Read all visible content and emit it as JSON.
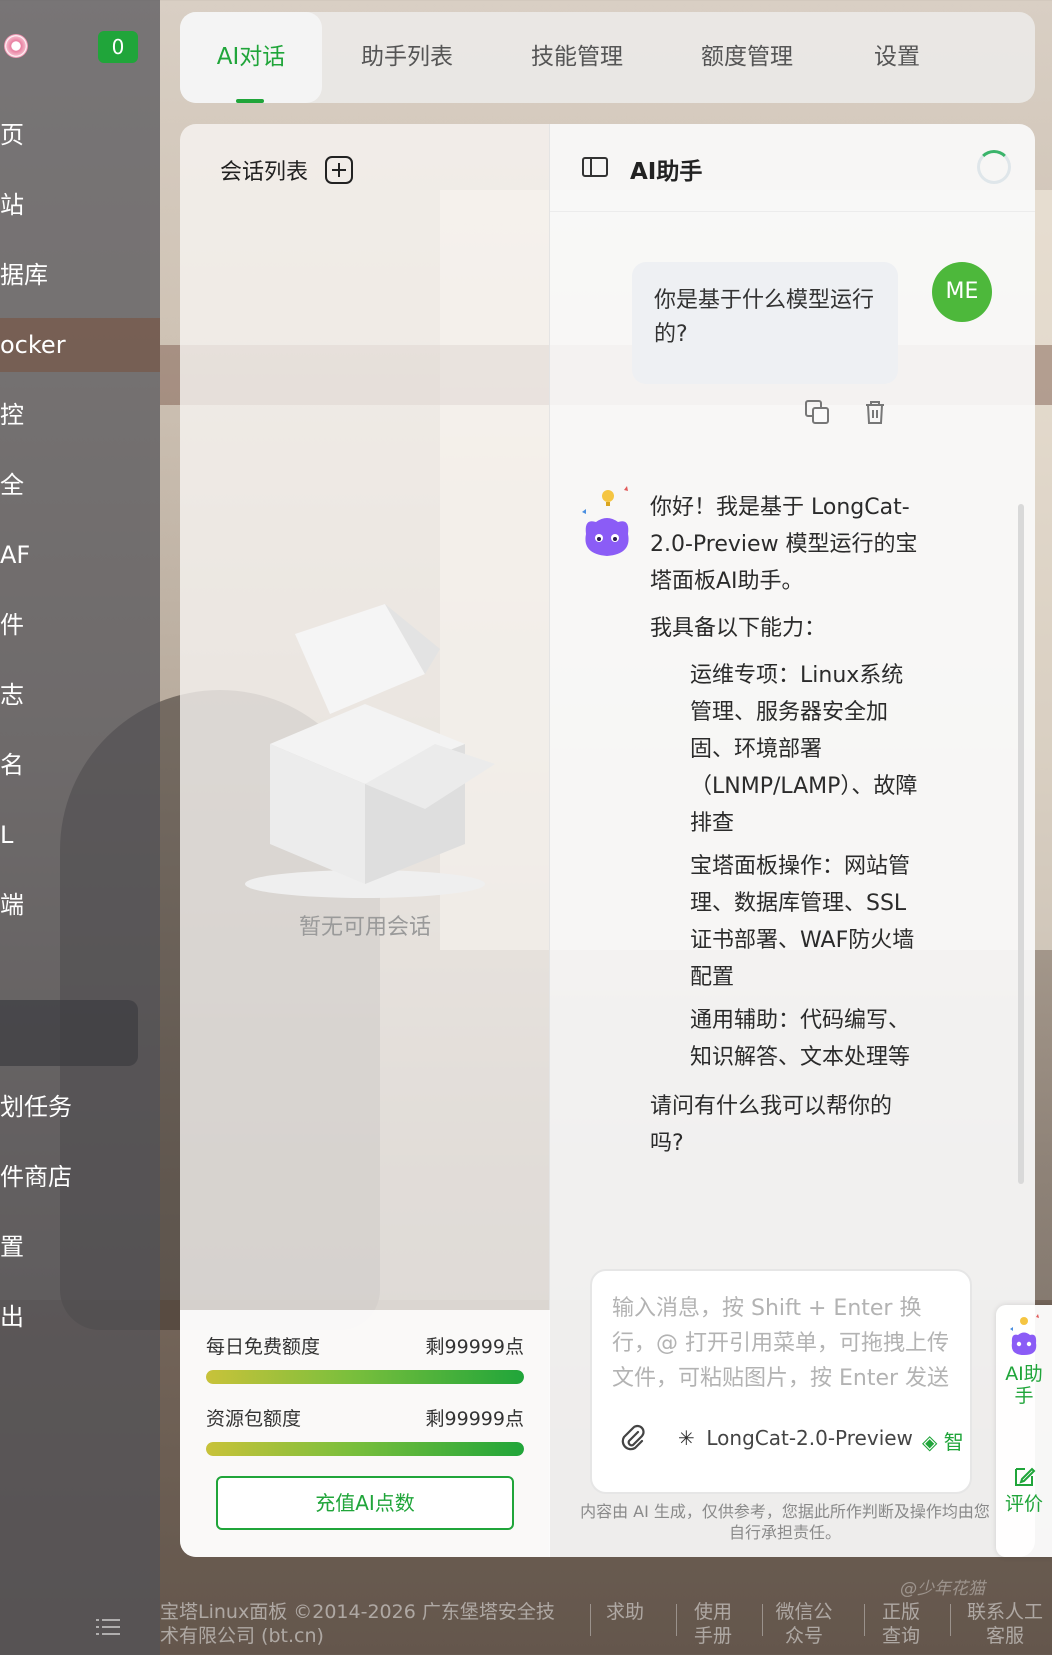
{
  "sidebar": {
    "badge": "0",
    "items": [
      {
        "label": "页"
      },
      {
        "label": "站"
      },
      {
        "label": "据库"
      },
      {
        "label": "ocker"
      },
      {
        "label": "控"
      },
      {
        "label": "全"
      },
      {
        "label": "AF"
      },
      {
        "label": "件"
      },
      {
        "label": "志"
      },
      {
        "label": "名"
      },
      {
        "label": "L"
      },
      {
        "label": "端"
      },
      {
        "label": ""
      },
      {
        "label": "划任务"
      },
      {
        "label": "件商店"
      },
      {
        "label": "置"
      },
      {
        "label": "出"
      }
    ]
  },
  "tabs": [
    {
      "label": "AI对话"
    },
    {
      "label": "助手列表"
    },
    {
      "label": "技能管理"
    },
    {
      "label": "额度管理"
    },
    {
      "label": "设置"
    }
  ],
  "session_list": {
    "title": "会话列表",
    "empty_text": "暂无可用会话"
  },
  "quota": {
    "daily_label": "每日免费额度",
    "daily_value": "剩99999点",
    "daily_fraction": 1.0,
    "package_label": "资源包额度",
    "package_value": "剩99999点",
    "package_fraction": 1.0,
    "recharge_label": "充值AI点数"
  },
  "chat": {
    "title": "AI助手",
    "user_avatar": "ME",
    "user_message": "你是基于什么模型运行的?",
    "ai_intro": "你好！我是基于 LongCat-2.0-Preview 模型运行的宝塔面板AI助手。",
    "ai_capabilities_title": "我具备以下能力：",
    "ai_capabilities": [
      "运维专项：Linux系统管理、服务器安全加固、环境部署（LNMP/LAMP）、故障排查",
      "宝塔面板操作：网站管理、数据库管理、SSL证书部署、WAF防火墙配置",
      "通用辅助：代码编写、知识解答、文本处理等"
    ],
    "ai_closing": "请问有什么我可以帮你的吗?",
    "input_placeholder": "输入消息，按 Shift + Enter 换行，@ 打开引用菜单，可拖拽上传文件，可粘贴图片，按 Enter 发送",
    "model_name": "LongCat-2.0-Preview",
    "smart_label": "智",
    "disclaimer": "内容由 AI 生成，仅供参考，您据此所作判断及操作均由您自行承担责任。"
  },
  "float_widget": {
    "ai_label": "AI助手",
    "rate_label": "评价"
  },
  "footer": {
    "copyright": "宝塔Linux面板 ©2014-2026 广东堡塔安全技术有限公司 (bt.cn)",
    "links": [
      "求助",
      "使用手册",
      "微信公众号",
      "正版查询",
      "联系人工客服"
    ]
  },
  "watermark": "@少年花猫"
}
